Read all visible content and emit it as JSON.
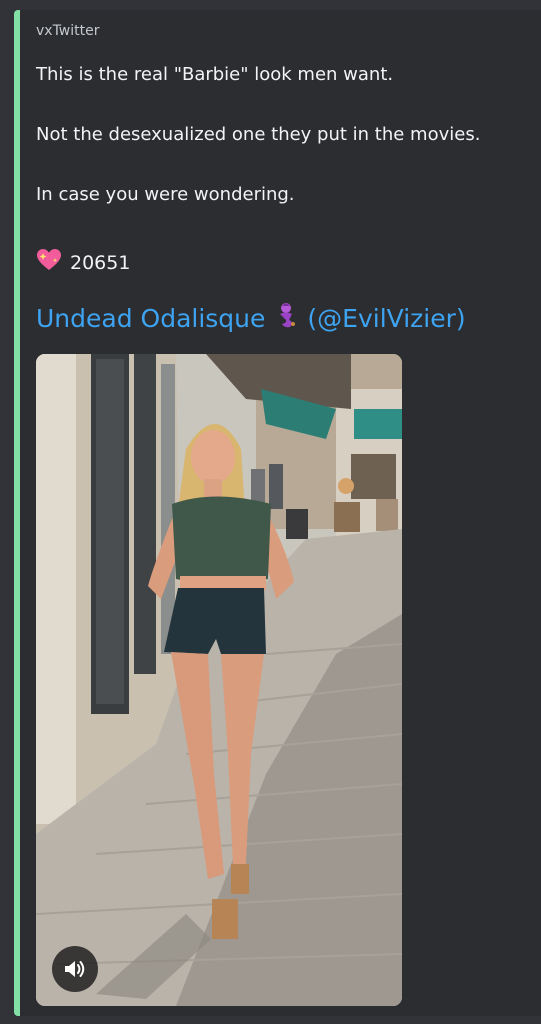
{
  "embed": {
    "provider": "vxTwitter",
    "description_lines": [
      "This is the real \"Barbie\" look men want.",
      "Not the desexualized one they put in the movies.",
      "In case you were wondering."
    ],
    "likes": {
      "icon": "sparkling-heart-icon",
      "count": "20651"
    },
    "author": {
      "name": "Undead Odalisque",
      "icon": "genie-emoji-icon",
      "handle": "(@EvilVizier)"
    },
    "media": {
      "type": "video",
      "control_icon": "speaker-volume-icon"
    },
    "colors": {
      "accent_bar": "#82e0a6",
      "link": "#3ea3f0",
      "embed_bg": "#2b2d31"
    }
  }
}
